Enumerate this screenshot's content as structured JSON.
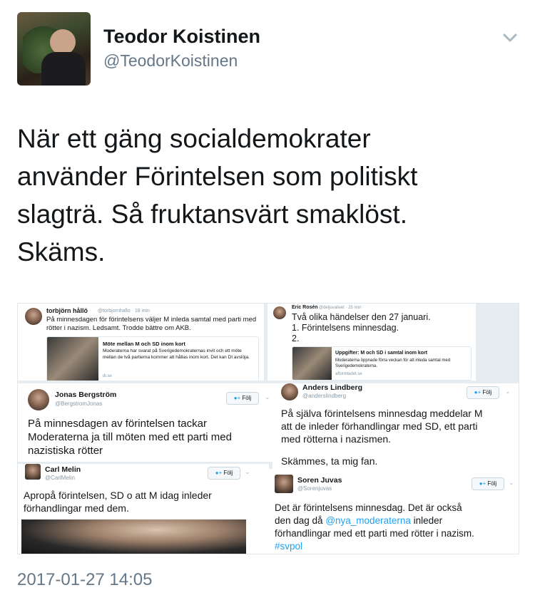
{
  "author": {
    "name": "Teodor Koistinen",
    "handle": "@TeodorKoistinen"
  },
  "tweet": {
    "text_lines": [
      "När ett gäng socialdemokrater",
      "använder Förintelsen som politiskt",
      "slagträ. Så fruktansvärt smaklöst.",
      "Skäms."
    ],
    "timestamp": "2017-01-27 14:05"
  },
  "collage": {
    "t1": {
      "name": "torbjörn hållö",
      "handle": "@torbjornhallo · 18 min",
      "body": "På minnesdagen för förintelsens väljer M inleda samtal med parti med rötter i nazism. Ledsamt. Trodde bättre om AKB.",
      "card_title": "Möte mellan M och SD inom kort",
      "card_desc": "Moderaterna har svarat på Sverigedemokraternas invit och ett möte mellan de två partierna kommer att hållas inom kort. Det kan DI avslöja.",
      "card_src": "di.se"
    },
    "t2": {
      "name": "Eric Rosén",
      "handle": "@deljuvalivet · 25 min",
      "line1": "Två olika händelser den 27 januari.",
      "line2": "1. Förintelsens minnesdag.",
      "line3": "2.",
      "card_title": "Uppgifter: M och SD i samtal inom kort",
      "card_desc": "Moderaterna öppnade förra veckan för att inleda samtal med Sverigedemokraterna.",
      "card_src": "aftonbladet.se"
    },
    "follow_label": "Följ",
    "t3": {
      "name": "Jonas Bergström",
      "handle": "@BergstromJonas",
      "lines": [
        "På minnesdagen av förintelsen tackar",
        "Moderaterna ja till möten med ett parti med",
        "nazistiska rötter"
      ]
    },
    "t4": {
      "name": "Anders Lindberg",
      "handle": "@anderslindberg",
      "lines": [
        "På själva förintelsens minnesdag meddelar M",
        "att de inleder förhandlingar med SD, ett parti",
        "med rötterna i nazismen."
      ],
      "line_after": "Skämmes, ta mig fan."
    },
    "t5": {
      "name": "Carl Melin",
      "handle": "@CarlMelin",
      "lines": [
        "Apropå förintelsen, SD o att M idag inleder",
        "förhandlingar med dem."
      ]
    },
    "t6": {
      "name": "Soren Juvas",
      "handle": "@Sorenjuvas",
      "line1": "Det är förintelsens minnesdag.  Det är också",
      "line2_pre": "den dag då ",
      "mention": "@nya_moderaterna",
      "line2_post": " inleder",
      "line3": "förhandlingar med ett parti med rötter i nazism.",
      "hashtag": "#svpol"
    }
  },
  "colors": {
    "text": "#14171a",
    "secondary": "#657786",
    "link": "#1da1f2"
  },
  "icons": [
    "chevron-down-icon",
    "follow-person-icon"
  ]
}
